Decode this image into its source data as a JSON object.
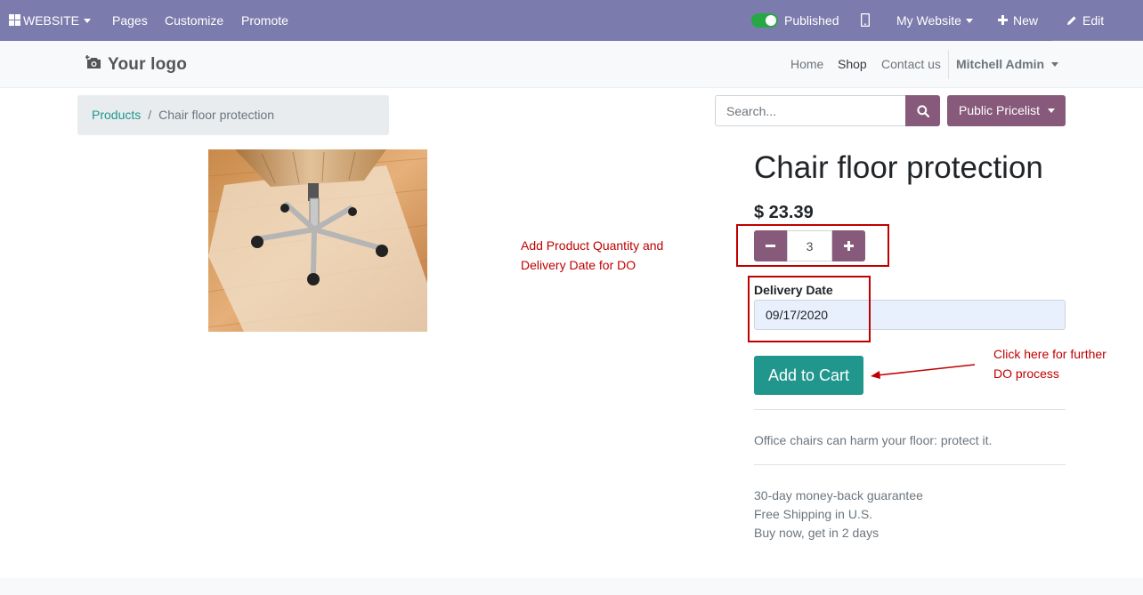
{
  "adminbar": {
    "website_label": "WEBSITE",
    "pages": "Pages",
    "customize": "Customize",
    "promote": "Promote",
    "published": "Published",
    "my_website": "My Website",
    "new": "New",
    "edit": "Edit"
  },
  "header": {
    "logo": "Your logo",
    "nav": {
      "home": "Home",
      "shop": "Shop",
      "contact": "Contact us",
      "user": "Mitchell Admin"
    }
  },
  "breadcrumb": {
    "parent": "Products",
    "separator": "/",
    "current": "Chair floor protection"
  },
  "search": {
    "placeholder": "Search..."
  },
  "pricelist": {
    "label": "Public Pricelist"
  },
  "product": {
    "title": "Chair floor protection",
    "price": "$ 23.39",
    "quantity": "3",
    "delivery_label": "Delivery Date",
    "delivery_date": "09/17/2020",
    "add_to_cart": "Add to Cart",
    "description": "Office chairs can harm your floor: protect it.",
    "terms": [
      "30-day money-back guarantee",
      "Free Shipping in U.S.",
      "Buy now, get in 2 days"
    ]
  },
  "annotations": {
    "qty_note_line1": "Add Product Quantity and",
    "qty_note_line2": "Delivery Date for DO",
    "cart_note_line1": "Click here for further",
    "cart_note_line2": "DO process"
  },
  "colors": {
    "admin_bar": "#7c7bad",
    "brand": "#875a7b",
    "accent": "#21968d",
    "annotation": "#c00000"
  }
}
